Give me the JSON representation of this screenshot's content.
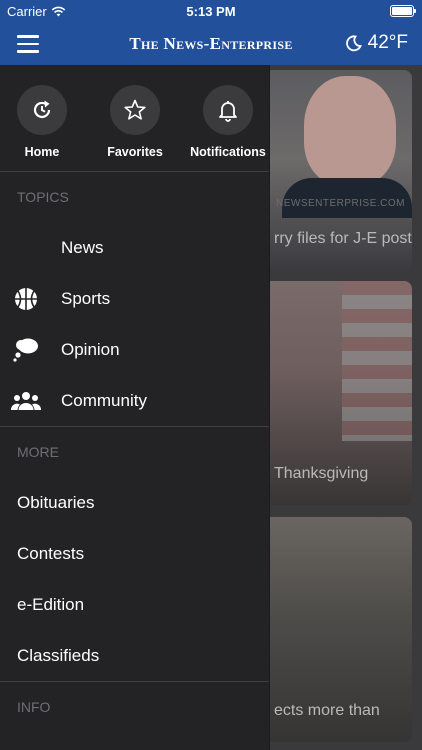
{
  "status_bar": {
    "carrier": "Carrier",
    "time": "5:13 PM"
  },
  "header": {
    "brand": "The News-Enterprise",
    "temperature": "42°F"
  },
  "quick_actions": [
    {
      "label": "Home",
      "icon": "refresh-icon"
    },
    {
      "label": "Favorites",
      "icon": "star-icon"
    },
    {
      "label": "Notifications",
      "icon": "bell-icon"
    }
  ],
  "sections": {
    "topics_title": "TOPICS",
    "more_title": "MORE",
    "info_title": "INFO"
  },
  "topics": [
    {
      "label": "News",
      "icon": ""
    },
    {
      "label": "Sports",
      "icon": "basketball-icon"
    },
    {
      "label": "Opinion",
      "icon": "thought-bubble-icon"
    },
    {
      "label": "Community",
      "icon": "people-icon"
    }
  ],
  "more": [
    {
      "label": "Obituaries"
    },
    {
      "label": "Contests"
    },
    {
      "label": "e-Edition"
    },
    {
      "label": "Classifieds"
    }
  ],
  "background_cards": [
    {
      "site": "NEWSENTERPRISE.COM",
      "caption": "rry files for J-E post"
    },
    {
      "caption": "Thanksgiving"
    },
    {
      "caption": "ects more than"
    }
  ],
  "colors": {
    "brand_blue": "#23509b",
    "drawer_bg": "#232325",
    "section_gray": "#6f6f73"
  }
}
